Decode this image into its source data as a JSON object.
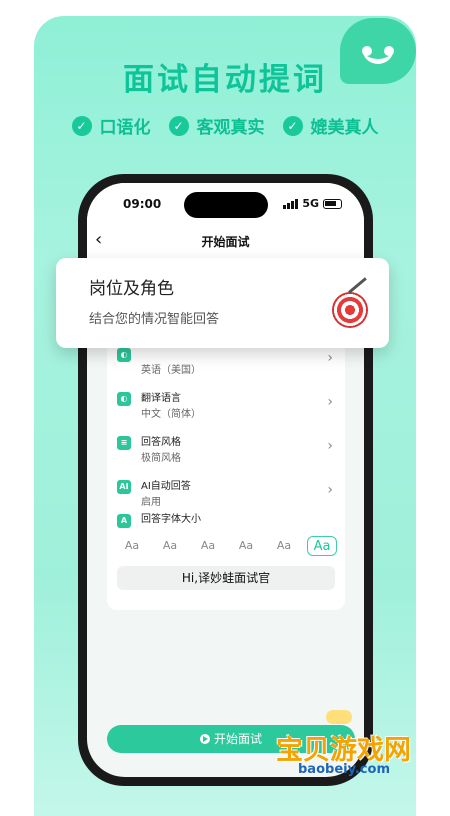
{
  "headline": "面试自动提词",
  "features": [
    "口语化",
    "客观真实",
    "媲美真人"
  ],
  "phone": {
    "status": {
      "time": "09:00",
      "network": "5G"
    },
    "nav": {
      "back": "‹",
      "title": "开始面试"
    },
    "settings": [
      {
        "icon": "globe-icon",
        "title": "",
        "value": "英语（美国）"
      },
      {
        "icon": "translate-icon",
        "title": "翻译语言",
        "value": "中文（简体）"
      },
      {
        "icon": "style-icon",
        "title": "回答风格",
        "value": "极简风格"
      },
      {
        "icon": "ai-icon",
        "icon_text": "AI",
        "title": "AI自动回答",
        "value": "启用"
      },
      {
        "icon": "font-size-icon",
        "icon_text": "A",
        "title": "回答字体大小",
        "value": ""
      }
    ],
    "font_sizes": [
      "Aa",
      "Aa",
      "Aa",
      "Aa",
      "Aa",
      "Aa"
    ],
    "font_size_selected_index": 5,
    "preview_text": "Hi,译妙蛙面试官",
    "start_button": "开始面试"
  },
  "popup": {
    "title": "岗位及角色",
    "subtitle": "结合您的情况智能回答",
    "icon": "target-icon"
  },
  "watermark": {
    "text": "宝贝游戏网",
    "url": "baobeiy.com"
  },
  "colors": {
    "accent": "#18c99a",
    "background_top": "#8ff0d6",
    "watermark": "#f4a300"
  }
}
